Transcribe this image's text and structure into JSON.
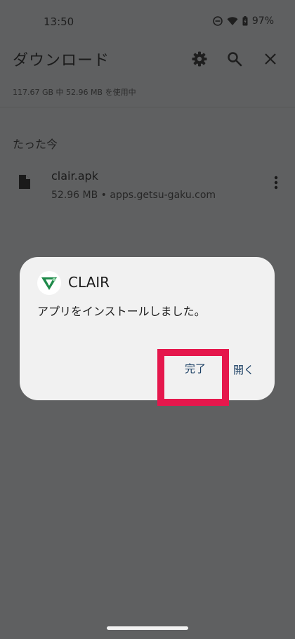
{
  "status_bar": {
    "time": "13:50",
    "battery": "97%",
    "icons": [
      "do-not-disturb-icon",
      "wifi-icon",
      "battery-icon"
    ]
  },
  "app_bar": {
    "title": "ダウンロード",
    "actions": [
      "gear-icon",
      "search-icon",
      "close-icon"
    ]
  },
  "storage": "117.67 GB 中 52.96 MB を使用中",
  "section": "たった今",
  "file": {
    "name": "clair.apk",
    "meta": "52.96 MB • apps.getsu-gaku.com"
  },
  "dialog": {
    "app_name": "CLAIR",
    "message": "アプリをインストールしました。",
    "done_label": "完了",
    "open_label": "開く"
  },
  "colors": {
    "scrim_background": "#5f6061",
    "dialog_background": "#f1f1f1",
    "button_text": "#1a3e63",
    "highlight": "#e5174c",
    "logo_green": "#1f8a4a"
  }
}
